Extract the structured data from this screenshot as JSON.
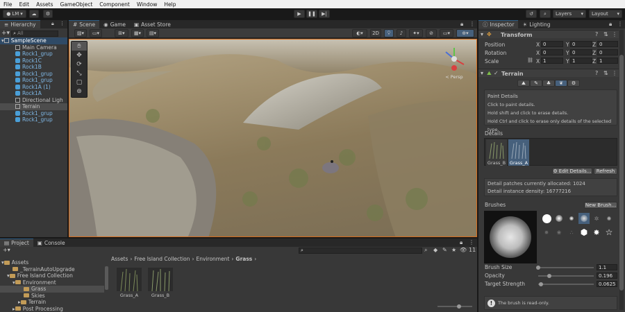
{
  "menubar": {
    "items": [
      "File",
      "Edit",
      "Assets",
      "GameObject",
      "Component",
      "Window",
      "Help"
    ]
  },
  "toolbar": {
    "account_label": "LM",
    "layers_label": "Layers",
    "layout_label": "Layout"
  },
  "hierarchy": {
    "tab_label": "Hierarchy",
    "search_placeholder": "All",
    "scene_name": "SampleScene",
    "items": [
      "Main Camera",
      "Rock1_grup",
      "Rock1C",
      "Rock1B",
      "Rock1_grup",
      "Rock1_grup",
      "Rock1A (1)",
      "Rock1A",
      "Directional Ligh",
      "Terrain",
      "Rock1_grup",
      "Rock1_grup"
    ]
  },
  "scene_tabs": [
    "Scene",
    "Game",
    "Asset Store"
  ],
  "scene_toolbar": {
    "mode_2d": "2D"
  },
  "scene": {
    "persp_label": "< Persp"
  },
  "inspector": {
    "tabs": [
      "Inspector",
      "Lighting"
    ],
    "transform": {
      "title": "Transform",
      "position_label": "Position",
      "rotation_label": "Rotation",
      "scale_label": "Scale",
      "axis": [
        "X",
        "Y",
        "Z"
      ],
      "position": [
        "0",
        "0",
        "0"
      ],
      "rotation": [
        "0",
        "0",
        "0"
      ],
      "scale": [
        "1",
        "1",
        "1"
      ]
    },
    "terrain": {
      "title": "Terrain",
      "paint_details_title": "Paint Details",
      "help1": "Click to paint details.",
      "help2": "Hold shift and click to erase details.",
      "help3": "Hold Ctrl and click to erase only details of the selected type.",
      "details_label": "Details",
      "detail_items": [
        "Grass_B",
        "Grass_A"
      ],
      "edit_details_button": "Edit Details...",
      "refresh_button": "Refresh",
      "patches_text": "Detail patches currently allocated: 1024",
      "density_text": "Detail instance density: 16777216",
      "brushes_label": "Brushes",
      "new_brush_button": "New Brush...",
      "brush_size_label": "Brush Size",
      "brush_size_value": "1.1",
      "opacity_label": "Opacity",
      "opacity_value": "0.196",
      "target_strength_label": "Target Strength",
      "target_strength_value": "0.0625",
      "readonly_note": "The brush is read-only."
    }
  },
  "project": {
    "tabs": [
      "Project",
      "Console"
    ],
    "count_badge": "11",
    "breadcrumb": [
      "Assets",
      "Free Island Collection",
      "Environment",
      "Grass"
    ],
    "tree": [
      "Assets",
      "_TerrainAutoUpgrade",
      "Free Island Collection",
      "Environment",
      "Grass",
      "Skies",
      "Terrain",
      "Post Processing"
    ],
    "assets": [
      "Grass_A",
      "Grass_B"
    ]
  },
  "colors": {
    "accent": "#2c5d87",
    "selected": "#46607c",
    "hierarchy_blue": "#4a9fd8"
  }
}
